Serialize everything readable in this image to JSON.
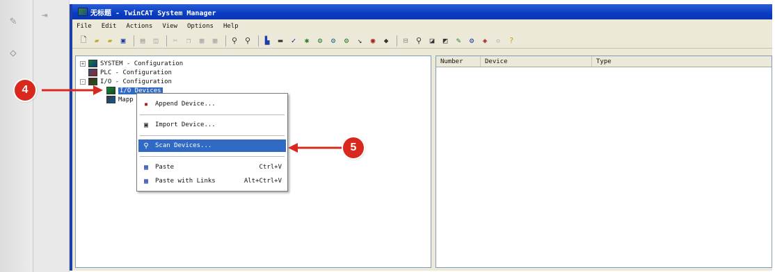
{
  "window": {
    "title": "无标题 - TwinCAT System Manager"
  },
  "menubar": [
    "File",
    "Edit",
    "Actions",
    "View",
    "Options",
    "Help"
  ],
  "toolbar": {
    "icons": [
      "new-icon",
      "open-icon",
      "open-folder-icon",
      "save-icon",
      "print-icon",
      "print-preview-icon",
      "cut-icon",
      "copy-icon",
      "paste-icon",
      "paste-special-icon",
      "find-icon",
      "find-next-icon",
      "activate-config-icon",
      "check-icon",
      "build-icon",
      "link-icon",
      "restart-icon",
      "scan-icon",
      "tree-icon",
      "debug-icon",
      "zoom-icon",
      "monitor-icon",
      "chart-icon",
      "edit-icon",
      "cfg-icon",
      "help-icon"
    ]
  },
  "tree": {
    "items": [
      {
        "label": "SYSTEM - Configuration",
        "expander": "+"
      },
      {
        "label": "PLC - Configuration",
        "expander": ""
      },
      {
        "label": "I/O - Configuration",
        "expander": "-"
      },
      {
        "label": "I/O Devices",
        "expander": ""
      },
      {
        "label": "Mapp",
        "expander": ""
      }
    ]
  },
  "list": {
    "columns": [
      "Number",
      "Device",
      "Type"
    ]
  },
  "context_menu": {
    "items": [
      {
        "label": "Append Device...",
        "shortcut": ""
      },
      {
        "label": "Import Device...",
        "shortcut": ""
      },
      {
        "label": "Scan Devices...",
        "shortcut": ""
      },
      {
        "label": "Paste",
        "shortcut": "Ctrl+V"
      },
      {
        "label": "Paste with Links",
        "shortcut": "Alt+Ctrl+V"
      }
    ]
  },
  "callouts": {
    "step4": "4",
    "step5": "5"
  },
  "colors": {
    "titlebar": "#0a3cc4",
    "selection": "#316ac5",
    "callout": "#d9281e"
  }
}
